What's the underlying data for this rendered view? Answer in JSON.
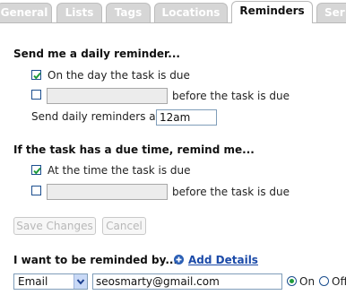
{
  "tabs": [
    {
      "label": "General",
      "active": false
    },
    {
      "label": "Lists",
      "active": false
    },
    {
      "label": "Tags",
      "active": false
    },
    {
      "label": "Locations",
      "active": false
    },
    {
      "label": "Reminders",
      "active": true
    },
    {
      "label": "Ser",
      "active": false
    }
  ],
  "daily": {
    "title": "Send me a daily reminder...",
    "on_day_label": "On the day the task is due",
    "on_day_checked": true,
    "before_checked": false,
    "before_label": "before the task is due",
    "time_label": "Send daily reminders at",
    "time_value": "12am"
  },
  "due_time": {
    "title": "If the task has a due time, remind me...",
    "at_time_label": "At the time the task is due",
    "at_time_checked": true,
    "before_checked": false,
    "before_label": "before the task is due"
  },
  "buttons": {
    "save": "Save Changes",
    "cancel": "Cancel"
  },
  "remind_by": {
    "title": "I want to be reminded by...",
    "add_details": "Add Details",
    "method": "Email",
    "address": "seosmarty@gmail.com",
    "on_label": "On",
    "off_label": "Off",
    "selected": "On"
  },
  "colors": {
    "checkbox_border": "#1c4f8f",
    "checkmark": "#1f9b3a",
    "link": "#1b4aa8"
  }
}
